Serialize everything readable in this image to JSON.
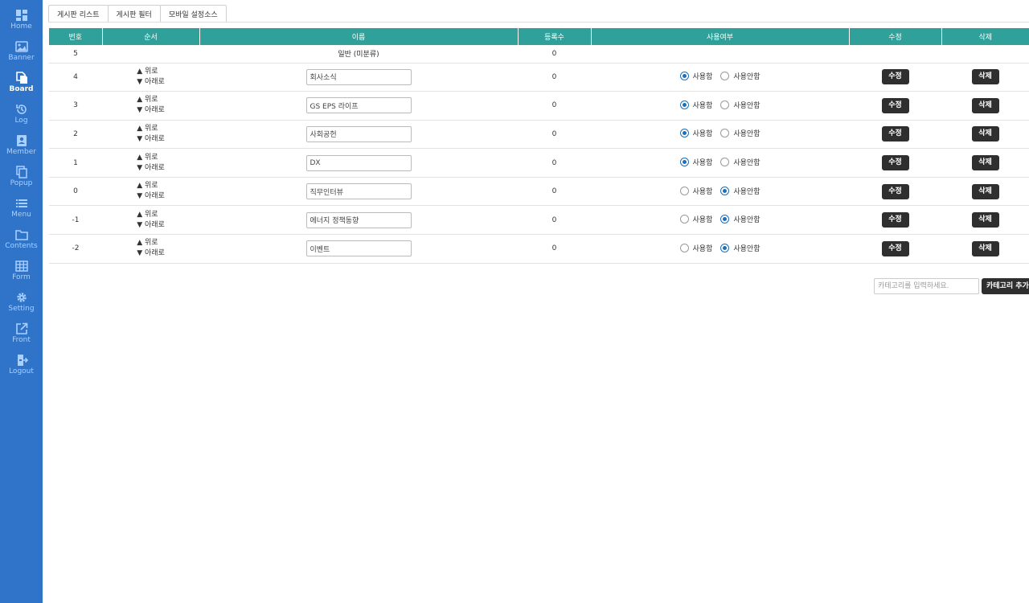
{
  "sidebar": {
    "items": [
      {
        "label": "Home",
        "icon": "dashboard-icon"
      },
      {
        "label": "Banner",
        "icon": "image-icon"
      },
      {
        "label": "Board",
        "icon": "document-icon"
      },
      {
        "label": "Log",
        "icon": "history-icon"
      },
      {
        "label": "Member",
        "icon": "contact-icon"
      },
      {
        "label": "Popup",
        "icon": "copy-icon"
      },
      {
        "label": "Menu",
        "icon": "list-icon"
      },
      {
        "label": "Contents",
        "icon": "folder-icon"
      },
      {
        "label": "Form",
        "icon": "table-icon"
      },
      {
        "label": "Setting",
        "icon": "gear-icon"
      },
      {
        "label": "Front",
        "icon": "external-link-icon"
      },
      {
        "label": "Logout",
        "icon": "logout-icon"
      }
    ],
    "active": "Board"
  },
  "tabs": [
    "게시판 리스트",
    "게시판 필터",
    "모바일 설정소스"
  ],
  "table": {
    "headers": {
      "number": "번호",
      "order": "순서",
      "name": "이름",
      "count": "등록수",
      "use": "사용여부",
      "edit": "수정",
      "delete": "삭제"
    },
    "first_row": {
      "number": "5",
      "name": "일반 (미분류)",
      "count": "0"
    },
    "order_up": "▲ 위로",
    "order_down": "▼ 아래로",
    "use_label": "사용함",
    "unuse_label": "사용안함",
    "edit_label": "수정",
    "delete_label": "삭제",
    "rows": [
      {
        "number": "4",
        "name": "회사소식",
        "count": "0",
        "use": true
      },
      {
        "number": "3",
        "name": "GS EPS 라이프",
        "count": "0",
        "use": true
      },
      {
        "number": "2",
        "name": "사회공헌",
        "count": "0",
        "use": true
      },
      {
        "number": "1",
        "name": "DX",
        "count": "0",
        "use": true
      },
      {
        "number": "0",
        "name": "직무인터뷰",
        "count": "0",
        "use": false
      },
      {
        "number": "-1",
        "name": "에너지 정책동향",
        "count": "0",
        "use": false
      },
      {
        "number": "-2",
        "name": "이벤트",
        "count": "0",
        "use": false
      }
    ]
  },
  "add_category": {
    "placeholder": "카테고리를 입력하세요.",
    "button_label": "카테고리 추가"
  }
}
